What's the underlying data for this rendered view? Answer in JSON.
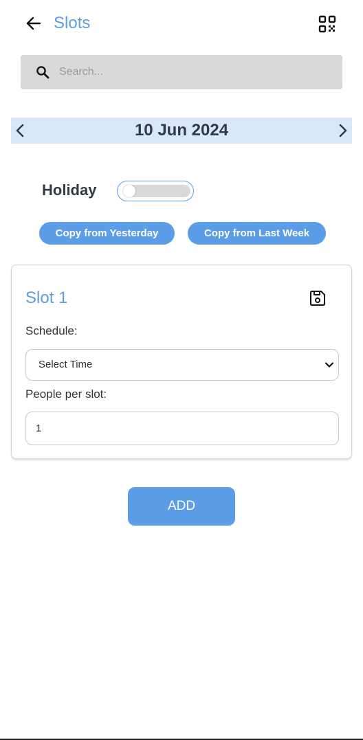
{
  "header": {
    "title": "Slots",
    "back_icon": "arrow-left-icon",
    "qr_icon": "qr-code-icon"
  },
  "search": {
    "placeholder": "Search..."
  },
  "date_nav": {
    "date": "10 Jun 2024",
    "prev_icon": "chevron-left-icon",
    "next_icon": "chevron-right-icon"
  },
  "holiday": {
    "label": "Holiday",
    "enabled": false
  },
  "copy_actions": {
    "yesterday_label": "Copy from Yesterday",
    "last_week_label": "Copy from Last Week"
  },
  "slot": {
    "title": "Slot 1",
    "save_icon": "save-icon",
    "schedule_label": "Schedule:",
    "schedule_value": "Select Time",
    "people_label": "People per slot:",
    "people_value": "1"
  },
  "add_label": "ADD",
  "colors": {
    "accent": "#5b9de6",
    "date_bar": "#d8e8fa",
    "search_bg": "#d9d9d9",
    "text_dark": "#333a45"
  }
}
